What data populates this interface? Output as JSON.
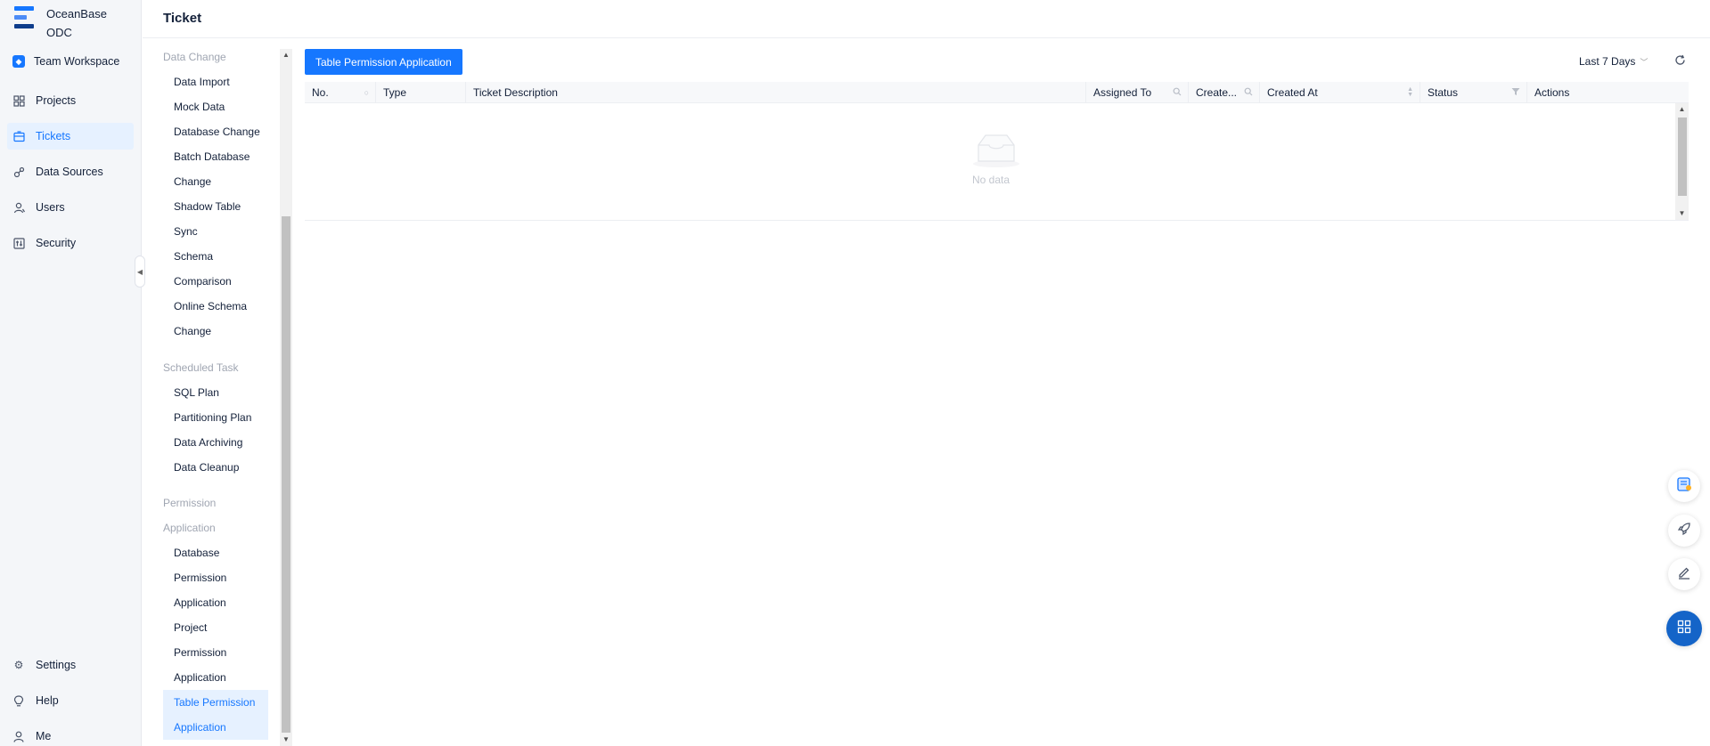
{
  "brand": {
    "line1": "OceanBase",
    "line2": "ODC"
  },
  "leftnav": {
    "workspace": "Team Workspace",
    "items": [
      {
        "label": "Projects",
        "icon": "projects-icon"
      },
      {
        "label": "Tickets",
        "icon": "tickets-icon",
        "active": true
      },
      {
        "label": "Data Sources",
        "icon": "data-sources-icon"
      },
      {
        "label": "Users",
        "icon": "users-icon"
      },
      {
        "label": "Security",
        "icon": "security-icon"
      }
    ],
    "bottom": [
      {
        "label": "Settings",
        "icon": "gear-icon"
      },
      {
        "label": "Help",
        "icon": "bulb-icon"
      },
      {
        "label": "Me",
        "icon": "user-icon"
      }
    ]
  },
  "header": {
    "title": "Ticket"
  },
  "ticket_types": {
    "group1": "Data Change",
    "group1_items": [
      "Data Import",
      "Mock Data",
      "Database Change",
      "Batch Database",
      "Change",
      "Shadow Table",
      "Sync",
      "Schema",
      "Comparison",
      "Online Schema",
      "Change"
    ],
    "group2": "Scheduled Task",
    "group2_items": [
      "SQL Plan",
      "Partitioning Plan",
      "Data Archiving",
      "Data Cleanup"
    ],
    "group3_line1": "Permission",
    "group3_line2": "Application",
    "group3_items": [
      "Database",
      "Permission",
      "Application",
      "Project",
      "Permission",
      "Application",
      "Table Permission",
      "Application"
    ]
  },
  "toolbar": {
    "create_label": "Table Permission Application",
    "range_label": "Last 7 Days"
  },
  "table": {
    "columns": [
      "No.",
      "Type",
      "Ticket Description",
      "Assigned To",
      "Create...",
      "Created At",
      "Status",
      "Actions"
    ],
    "empty_text": "No data"
  },
  "colors": {
    "accent": "#1677ff",
    "nav_active_bg": "#e6f1ff",
    "fab_primary": "#1464c8"
  }
}
